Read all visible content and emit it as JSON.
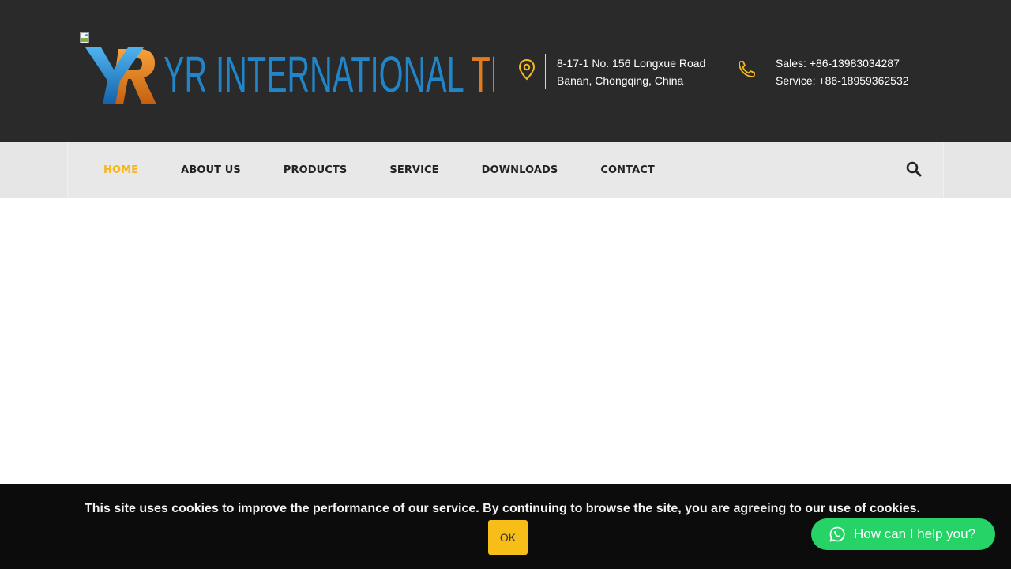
{
  "header": {
    "logo": {
      "wordmark_part1": "YR INTERNATIONAL ",
      "wordmark_part2": "TRADING",
      "monogram": "YR",
      "colors": {
        "blue": "#2185c9",
        "orange": "#e07b1f"
      }
    },
    "address": {
      "icon": "map-pin-icon",
      "line1": "8-17-1 No. 156 Longxue Road",
      "line2": "Banan, Chongqing, China"
    },
    "phones": {
      "icon": "phone-icon",
      "sales": "Sales: +86-13983034287",
      "service": "Service: +86-18959362532"
    }
  },
  "nav": {
    "items": [
      {
        "label": "HOME",
        "active": true
      },
      {
        "label": "ABOUT US",
        "active": false
      },
      {
        "label": "PRODUCTS",
        "active": false
      },
      {
        "label": "SERVICE",
        "active": false
      },
      {
        "label": "DOWNLOADS",
        "active": false
      },
      {
        "label": "CONTACT",
        "active": false
      }
    ],
    "search_icon": "search-icon",
    "active_color": "#f5b81c"
  },
  "cookie_banner": {
    "message": "This site uses cookies to improve the performance of our service. By continuing to browse the site, you are agreeing to our use of cookies.",
    "ok_label": "OK",
    "button_color": "#f7be17"
  },
  "chat_widget": {
    "label": "How can I help you?",
    "icon": "whatsapp-icon",
    "color": "#25d366"
  }
}
